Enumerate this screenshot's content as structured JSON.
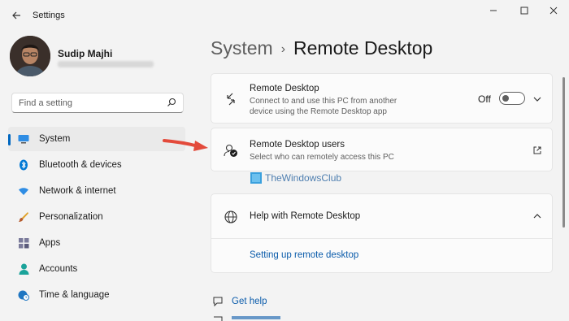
{
  "window": {
    "title": "Settings",
    "back_icon": "back-arrow-icon",
    "controls": [
      "minimize-icon",
      "maximize-icon",
      "close-icon"
    ]
  },
  "user": {
    "name": "Sudip Majhi",
    "avatar_icon": "avatar"
  },
  "search": {
    "placeholder": "Find a setting",
    "icon": "search-icon"
  },
  "nav": {
    "items": [
      {
        "label": "System",
        "icon": "system-display-icon",
        "active": true,
        "color": "#0067c0"
      },
      {
        "label": "Bluetooth & devices",
        "icon": "bluetooth-icon",
        "color": "#0078d4"
      },
      {
        "label": "Network & internet",
        "icon": "wifi-icon",
        "color": "#2f8de4"
      },
      {
        "label": "Personalization",
        "icon": "brush-icon",
        "color": "#b65c2e"
      },
      {
        "label": "Apps",
        "icon": "apps-icon",
        "color": "#6b6b8a"
      },
      {
        "label": "Accounts",
        "icon": "person-icon",
        "color": "#1aa39a"
      },
      {
        "label": "Time & language",
        "icon": "globe-clock-icon",
        "color": "#1f76c2"
      }
    ]
  },
  "breadcrumb": {
    "parent": "System",
    "separator": "›",
    "current": "Remote Desktop"
  },
  "cards": {
    "remote_desktop": {
      "title": "Remote Desktop",
      "description_line1": "Connect to and use this PC from another",
      "description_line2": "device using the Remote Desktop app",
      "toggle_label": "Off",
      "toggle_on": false,
      "icon": "remote-desktop-icon"
    },
    "remote_users": {
      "title": "Remote Desktop users",
      "description": "Select who can remotely access this PC",
      "icon": "remote-users-icon",
      "action_icon": "open-external-icon"
    },
    "help": {
      "title": "Help with Remote Desktop",
      "link": "Setting up remote desktop",
      "icon": "globe-icon",
      "expanded": true
    }
  },
  "watermark": {
    "text": "TheWindowsClub"
  },
  "footer": {
    "get_help": "Get help"
  },
  "colors": {
    "accent": "#0067c0",
    "link": "#0b5cab",
    "annotation_arrow": "#e34a3b"
  }
}
